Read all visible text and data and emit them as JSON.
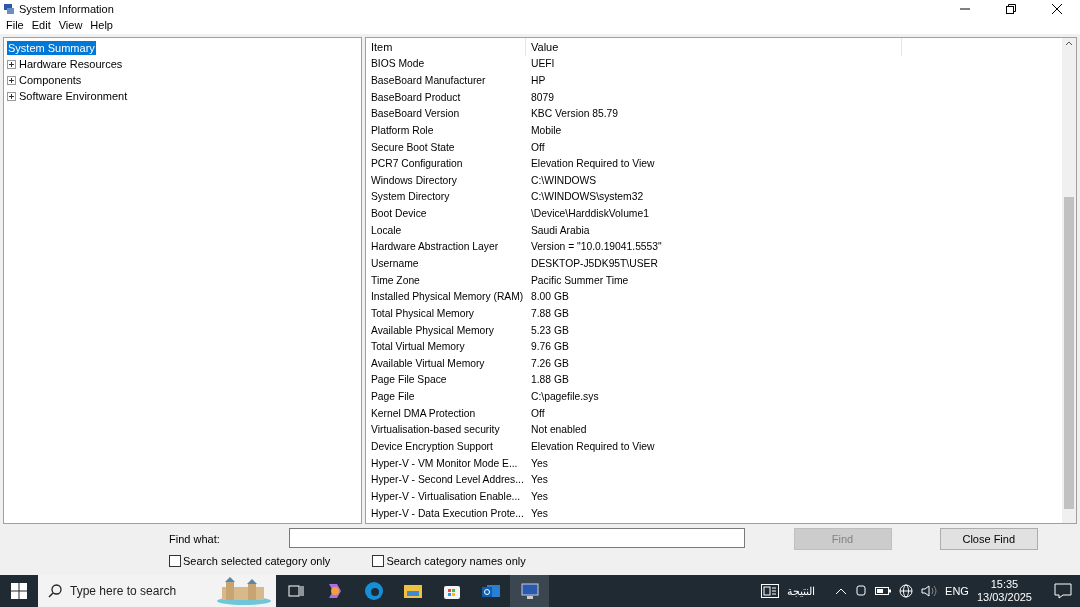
{
  "window": {
    "title": "System Information"
  },
  "menu": [
    "File",
    "Edit",
    "View",
    "Help"
  ],
  "tree": [
    {
      "label": "System Summary",
      "selected": true,
      "expandable": false
    },
    {
      "label": "Hardware Resources",
      "selected": false,
      "expandable": true
    },
    {
      "label": "Components",
      "selected": false,
      "expandable": true
    },
    {
      "label": "Software Environment",
      "selected": false,
      "expandable": true
    }
  ],
  "table": {
    "columns": [
      "Item",
      "Value"
    ],
    "rows": [
      [
        "BIOS Mode",
        "UEFI"
      ],
      [
        "BaseBoard Manufacturer",
        "HP"
      ],
      [
        "BaseBoard Product",
        "8079"
      ],
      [
        "BaseBoard Version",
        "KBC Version 85.79"
      ],
      [
        "Platform Role",
        "Mobile"
      ],
      [
        "Secure Boot State",
        "Off"
      ],
      [
        "PCR7 Configuration",
        "Elevation Required to View"
      ],
      [
        "Windows Directory",
        "C:\\WINDOWS"
      ],
      [
        "System Directory",
        "C:\\WINDOWS\\system32"
      ],
      [
        "Boot Device",
        "\\Device\\HarddiskVolume1"
      ],
      [
        "Locale",
        "Saudi Arabia"
      ],
      [
        "Hardware Abstraction Layer",
        "Version = \"10.0.19041.5553\""
      ],
      [
        "Username",
        "DESKTOP-J5DK95T\\USER"
      ],
      [
        "Time Zone",
        "Pacific Summer Time"
      ],
      [
        "Installed Physical Memory (RAM)",
        "8.00 GB"
      ],
      [
        "Total Physical Memory",
        "7.88 GB"
      ],
      [
        "Available Physical Memory",
        "5.23 GB"
      ],
      [
        "Total Virtual Memory",
        "9.76 GB"
      ],
      [
        "Available Virtual Memory",
        "7.26 GB"
      ],
      [
        "Page File Space",
        "1.88 GB"
      ],
      [
        "Page File",
        "C:\\pagefile.sys"
      ],
      [
        "Kernel DMA Protection",
        "Off"
      ],
      [
        "Virtualisation-based security",
        "Not enabled"
      ],
      [
        "Device Encryption Support",
        "Elevation Required to View"
      ],
      [
        "Hyper-V - VM Monitor Mode E...",
        "Yes"
      ],
      [
        "Hyper-V - Second Level Addres...",
        "Yes"
      ],
      [
        "Hyper-V - Virtualisation Enable...",
        "Yes"
      ],
      [
        "Hyper-V - Data Execution Prote...",
        "Yes"
      ]
    ]
  },
  "find": {
    "label": "Find what:",
    "find_button": {
      "label": "Find",
      "disabled": true
    },
    "close_button": {
      "label": "Close Find",
      "disabled": false
    },
    "options": [
      {
        "label": "Search selected category only",
        "checked": false
      },
      {
        "label": "Search category names only",
        "checked": false
      }
    ]
  },
  "taskbar": {
    "search": {
      "placeholder": "Type here to search"
    },
    "news": "النتيجة",
    "language": "ENG",
    "time": "15:35",
    "date": "13/03/2025"
  }
}
